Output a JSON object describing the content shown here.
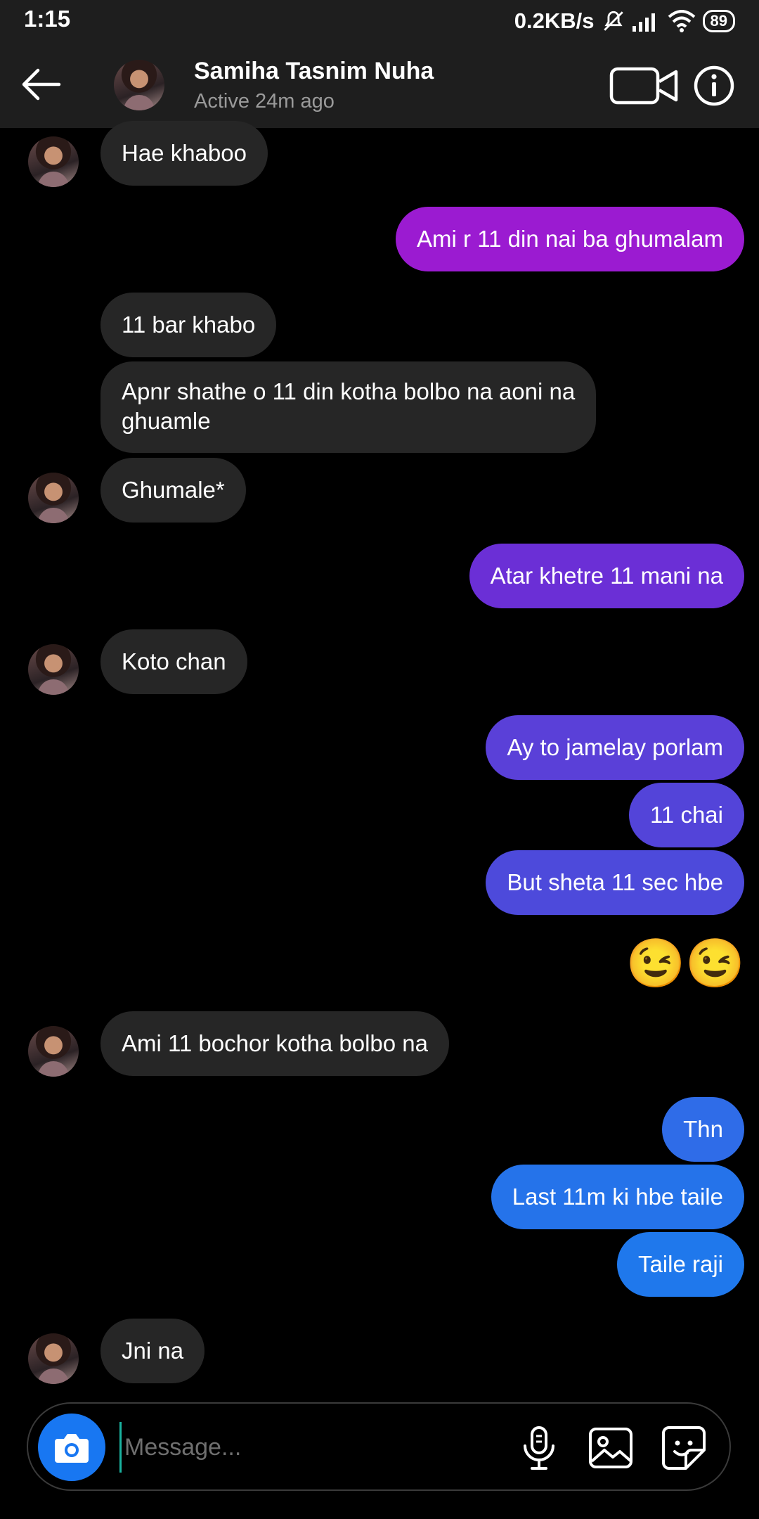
{
  "status_bar": {
    "time": "1:15",
    "network_speed": "0.2KB/s",
    "battery": "89"
  },
  "header": {
    "contact_name": "Samiha Tasnim Nuha",
    "contact_status": "Active 24m ago"
  },
  "messages": [
    {
      "from": "them",
      "text": "Hae khaboo"
    },
    {
      "from": "me",
      "text": "Ami r 11 din nai ba ghumalam",
      "color": "#9b1bd1"
    },
    {
      "from": "them",
      "text": "11 bar khabo"
    },
    {
      "from": "them",
      "text": "Apnr shathe o 11 din kotha bolbo na aoni na",
      "text2": "ghuamle"
    },
    {
      "from": "them",
      "text": "Ghumale*"
    },
    {
      "from": "me",
      "text": "Atar khetre 11 mani na",
      "color": "#6b2fd6"
    },
    {
      "from": "them",
      "text": "Koto chan"
    },
    {
      "from": "me",
      "text": "Ay to jamelay porlam",
      "color": "#5a40d8"
    },
    {
      "from": "me",
      "text": "11 chai",
      "color": "#5344d9"
    },
    {
      "from": "me",
      "text": "But sheta 11 sec hbe",
      "color": "#4d4adb"
    },
    {
      "from": "me",
      "text": "😉😉"
    },
    {
      "from": "them",
      "text": "Ami 11 bochor kotha bolbo na"
    },
    {
      "from": "me",
      "text": "Thn",
      "color": "#2f6ce8"
    },
    {
      "from": "me",
      "text": "Last 11m ki hbe taile",
      "color": "#2573ea"
    },
    {
      "from": "me",
      "text": "Taile raji",
      "color": "#1f78ec"
    },
    {
      "from": "them",
      "text": "Jni na"
    }
  ],
  "composer": {
    "placeholder": "Message..."
  },
  "icons": [
    "back-arrow-icon",
    "video-camera-icon",
    "info-icon",
    "camera-icon",
    "microphone-icon",
    "gallery-icon",
    "sticker-icon"
  ]
}
